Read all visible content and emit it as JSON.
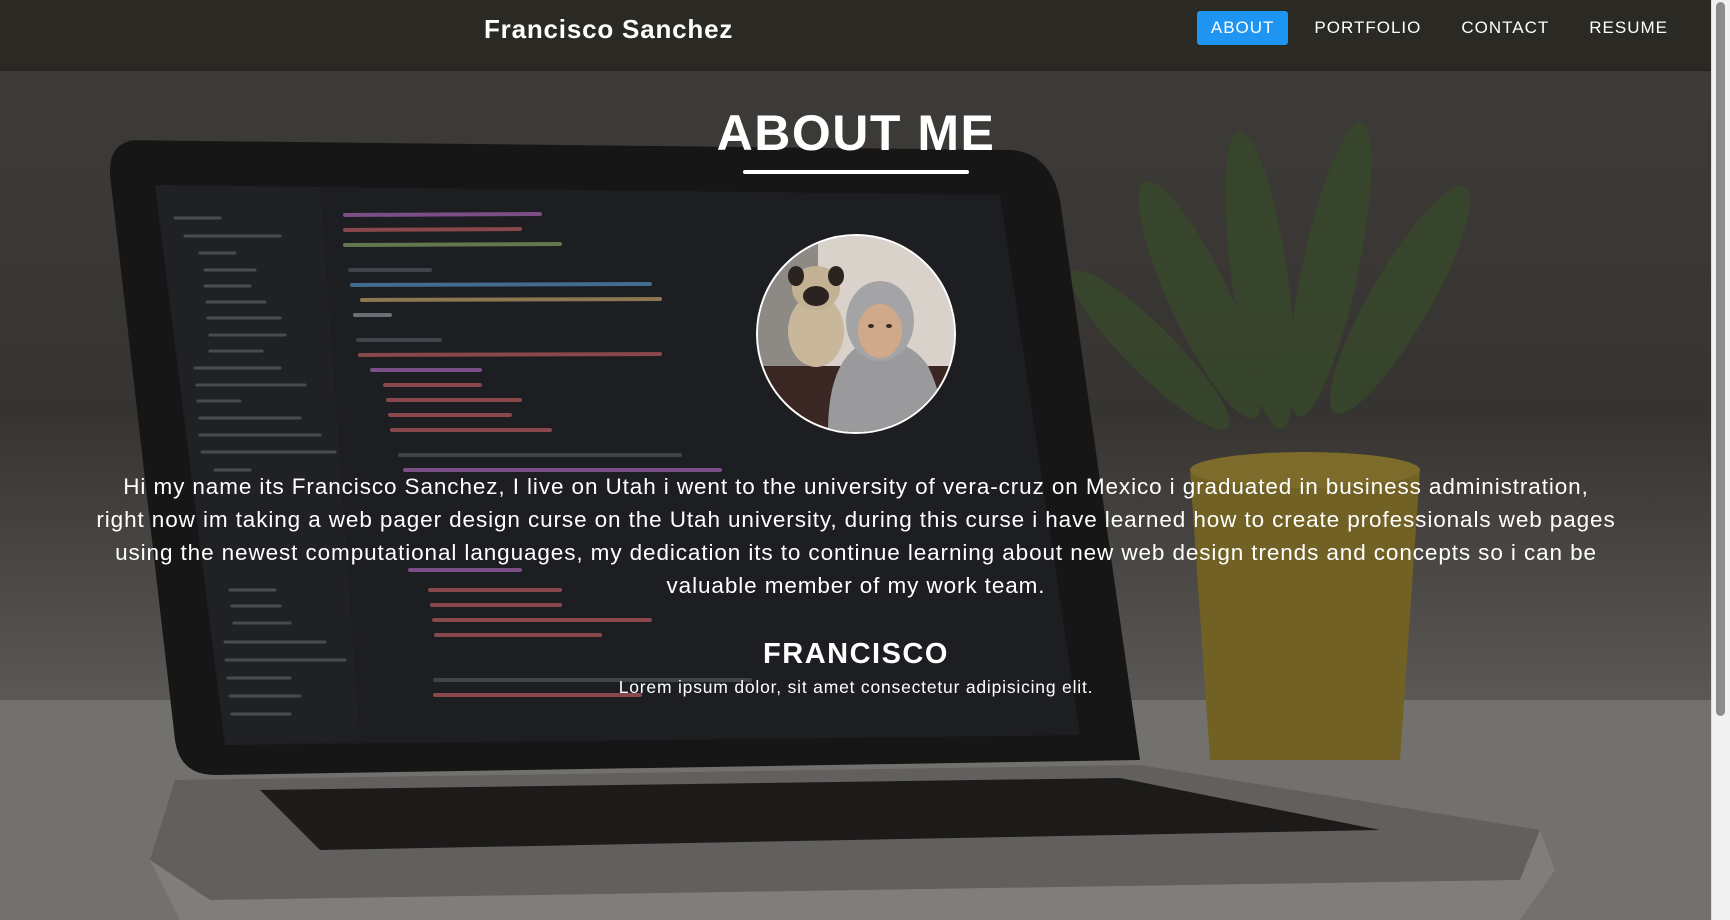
{
  "header": {
    "brand": "Francisco Sanchez",
    "nav": [
      {
        "label": "ABOUT",
        "active": true
      },
      {
        "label": "PORTFOLIO",
        "active": false
      },
      {
        "label": "CONTACT",
        "active": false
      },
      {
        "label": "RESUME",
        "active": false
      }
    ]
  },
  "main": {
    "title": "ABOUT ME",
    "bio": "Hi my name its Francisco Sanchez, I live on Utah i went to the university of vera-cruz on Mexico i graduated in business administration, right now im taking a web pager design curse on the Utah university, during this curse i have learned how to create professionals web pages using the newest computational languages, my dedication its to continue learning about new web design trends and concepts so i can be valuable member of my work team.",
    "name": "FRANCISCO",
    "tagline": "Lorem ipsum dolor, sit amet consectetur adipisicing elit."
  },
  "colors": {
    "navbar": "#2b2924",
    "active_nav": "#1e95f3",
    "text": "#ffffff"
  },
  "icons": {
    "avatar": "profile-photo-person-with-pug"
  }
}
